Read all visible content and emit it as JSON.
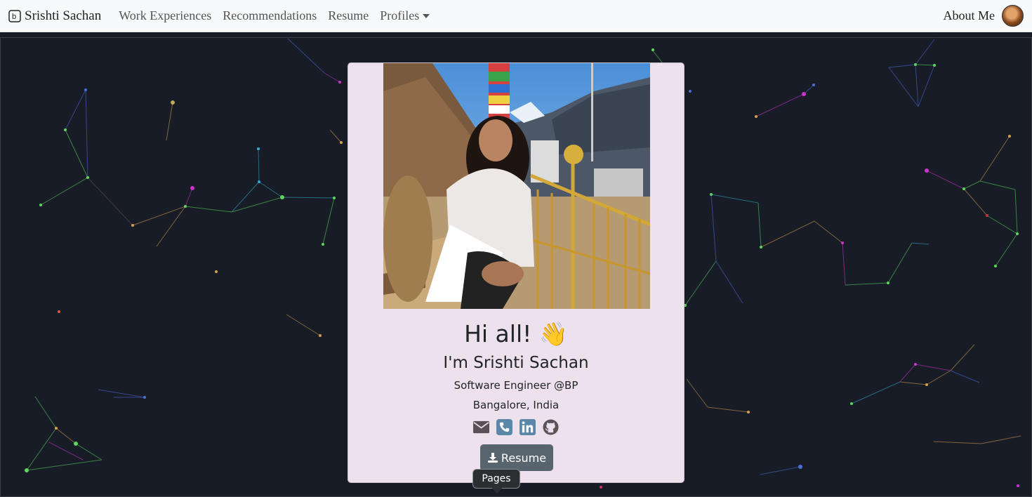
{
  "nav": {
    "brand": "Srishti Sachan",
    "links": [
      "Work Experiences",
      "Recommendations",
      "Resume"
    ],
    "profiles": "Profiles",
    "about": "About Me"
  },
  "card": {
    "greeting": "Hi all! 👋",
    "name": "I'm Srishti Sachan",
    "role": "Software Engineer @BP",
    "location": "Bangalore, India",
    "resume_button": "Resume"
  },
  "tooltip": "Pages",
  "colors": {
    "nav_bg": "#f8f9fa",
    "page_bg": "#181c27",
    "card_bg": "#ece1ec",
    "button_bg": "#58656f",
    "icon_blue": "#5b87a8"
  },
  "icons": [
    "envelope-icon",
    "phone-icon",
    "linkedin-icon",
    "github-icon",
    "download-icon"
  ]
}
